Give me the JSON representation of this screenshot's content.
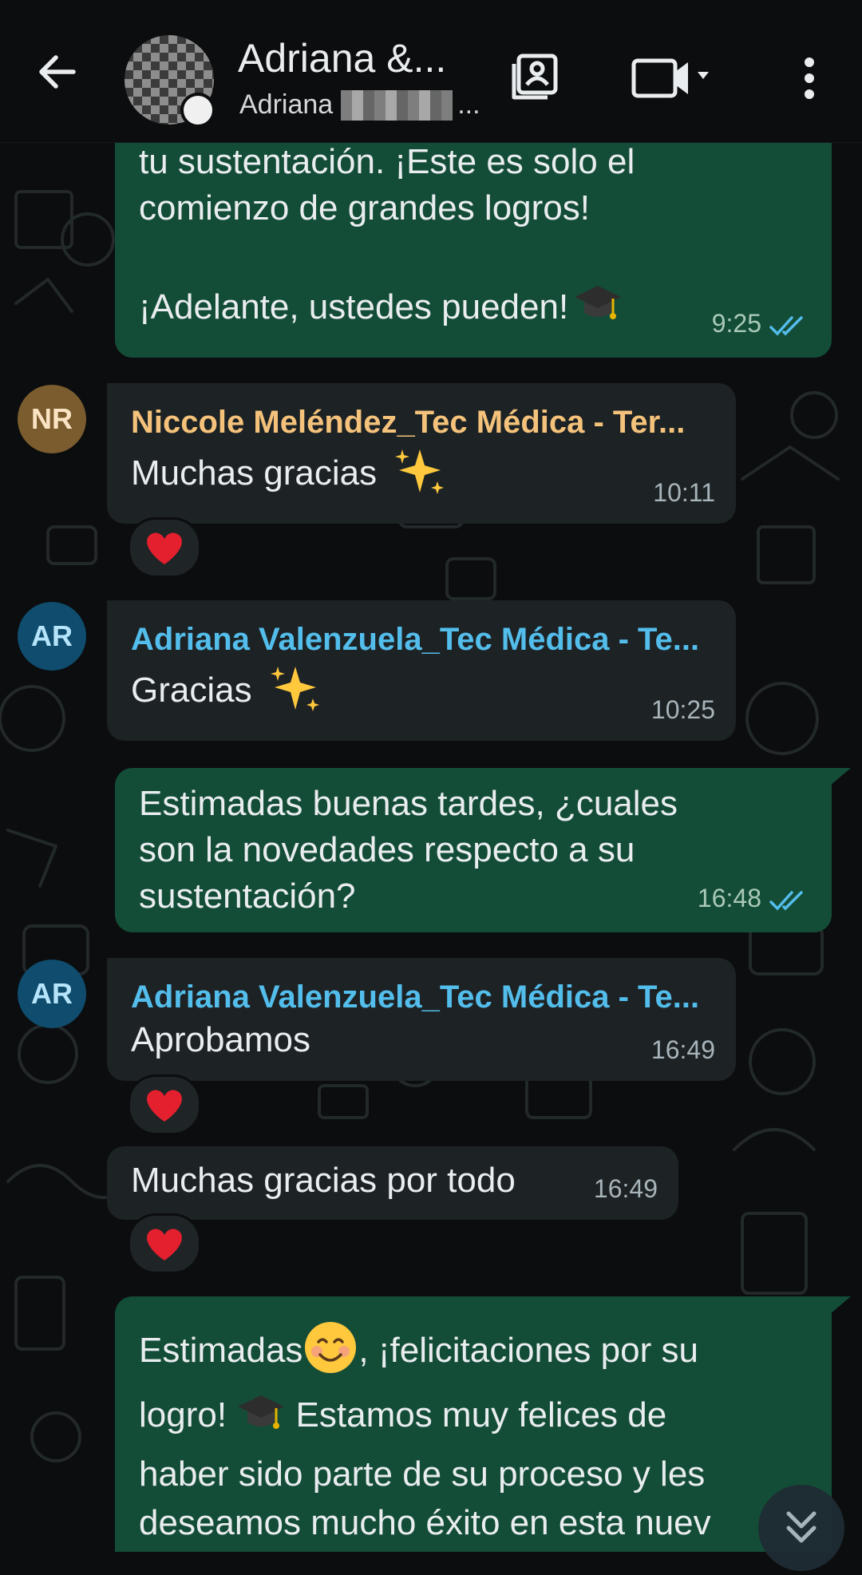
{
  "header": {
    "title": "Adriana &...",
    "subtitle_prefix": "Adriana",
    "subtitle_suffix": "..."
  },
  "messages": [
    {
      "id": "m1",
      "direction": "outgoing",
      "lines": [
        "tu sustentación. ¡Este es solo el",
        "comienzo de grandes logros!",
        "",
        "¡Adelante, ustedes pueden!"
      ],
      "time": "9:25",
      "status": "read"
    },
    {
      "id": "m2",
      "direction": "incoming",
      "avatar": "NR",
      "sender": "Niccole Meléndez_Tec Médica - Ter...",
      "text": "Muchas gracias",
      "time": "10:11",
      "reaction": "heart"
    },
    {
      "id": "m3",
      "direction": "incoming",
      "avatar": "AR",
      "sender": "Adriana Valenzuela_Tec Médica - Te...",
      "text": "Gracias",
      "time": "10:25"
    },
    {
      "id": "m4",
      "direction": "outgoing",
      "lines": [
        "Estimadas buenas tardes, ¿cuales",
        "son la novedades respecto a su",
        "sustentación?"
      ],
      "time": "16:48",
      "status": "read"
    },
    {
      "id": "m5",
      "direction": "incoming",
      "avatar": "AR",
      "sender": "Adriana Valenzuela_Tec Médica - Te...",
      "text": "Aprobamos",
      "time": "16:49",
      "reaction": "heart"
    },
    {
      "id": "m6",
      "direction": "incoming",
      "text": "Muchas gracias por todo",
      "time": "16:49",
      "reaction": "heart"
    },
    {
      "id": "m7",
      "direction": "outgoing",
      "line1a": "Estimadas",
      "line1b": ", ¡felicitaciones por su",
      "line2a": "logro!",
      "line2b": " Estamos muy felices de",
      "line3": "haber sido parte de su proceso y les",
      "line4": "deseamos mucho éxito en esta nuev"
    }
  ],
  "colors": {
    "outgoing_bubble": "#144d37",
    "incoming_bubble": "#1d2225",
    "sender_orange": "#f4c27a",
    "sender_blue": "#53bdeb",
    "read_ticks": "#53bdeb"
  },
  "icons": {
    "back": "arrow-left-icon",
    "contact": "contact-card-icon",
    "video": "video-camera-icon",
    "more": "more-vert-icon",
    "sparkles": "sparkles-emoji",
    "graduation": "graduation-cap-emoji",
    "smile": "smiling-face-emoji",
    "heart": "red-heart-emoji"
  }
}
